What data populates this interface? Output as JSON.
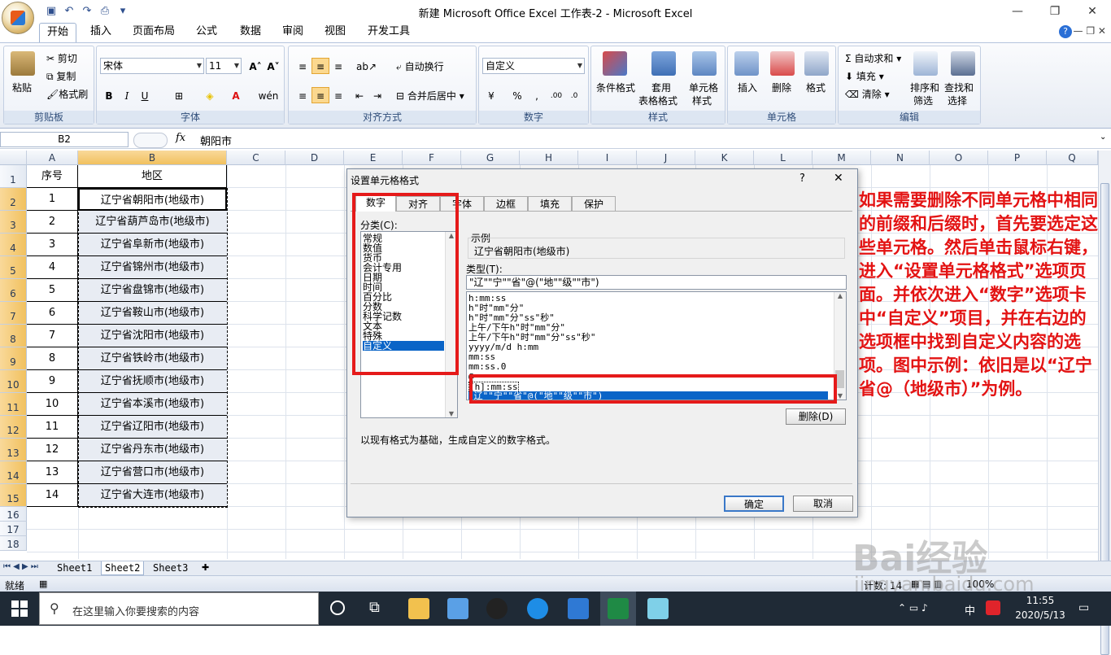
{
  "window": {
    "title": "新建 Microsoft Office Excel 工作表-2 - Microsoft Excel"
  },
  "ribbon_tabs": [
    "开始",
    "插入",
    "页面布局",
    "公式",
    "数据",
    "审阅",
    "视图",
    "开发工具"
  ],
  "ribbon": {
    "clipboard": {
      "label": "剪贴板",
      "paste": "粘贴",
      "cut": "剪切",
      "copy": "复制",
      "format_painter": "格式刷"
    },
    "font": {
      "label": "字体",
      "font_name": "宋体",
      "font_size": "11"
    },
    "alignment": {
      "label": "对齐方式",
      "wrap_text": "自动换行",
      "merge_center": "合并后居中"
    },
    "number": {
      "label": "数字",
      "format": "自定义"
    },
    "styles": {
      "label": "样式",
      "cond_format": "条件格式",
      "table_format_1": "套用",
      "table_format_2": "表格格式",
      "cell_styles_1": "单元格",
      "cell_styles_2": "样式"
    },
    "cells": {
      "label": "单元格",
      "insert": "插入",
      "delete": "删除",
      "format": "格式"
    },
    "editing": {
      "label": "编辑",
      "autosum": "自动求和",
      "fill": "填充",
      "clear": "清除",
      "sort_1": "排序和",
      "sort_2": "筛选",
      "find_1": "查找和",
      "find_2": "选择"
    }
  },
  "formula_bar": {
    "name_box": "B2",
    "fx": "fx",
    "content": "朝阳市"
  },
  "columns": [
    "A",
    "B",
    "C",
    "D",
    "E",
    "F",
    "G",
    "H",
    "I",
    "J",
    "K",
    "L",
    "M",
    "N",
    "O",
    "P",
    "Q"
  ],
  "rows": [
    "1",
    "2",
    "3",
    "4",
    "5",
    "6",
    "7",
    "8",
    "9",
    "10",
    "11",
    "12",
    "13",
    "14",
    "15",
    "16",
    "17",
    "18"
  ],
  "table": {
    "header": {
      "a": "序号",
      "b": "地区"
    },
    "rows": [
      {
        "a": "1",
        "b": "辽宁省朝阳市(地级市)"
      },
      {
        "a": "2",
        "b": "辽宁省葫芦岛市(地级市)"
      },
      {
        "a": "3",
        "b": "辽宁省阜新市(地级市)"
      },
      {
        "a": "4",
        "b": "辽宁省锦州市(地级市)"
      },
      {
        "a": "5",
        "b": "辽宁省盘锦市(地级市)"
      },
      {
        "a": "6",
        "b": "辽宁省鞍山市(地级市)"
      },
      {
        "a": "7",
        "b": "辽宁省沈阳市(地级市)"
      },
      {
        "a": "8",
        "b": "辽宁省铁岭市(地级市)"
      },
      {
        "a": "9",
        "b": "辽宁省抚顺市(地级市)"
      },
      {
        "a": "10",
        "b": "辽宁省本溪市(地级市)"
      },
      {
        "a": "11",
        "b": "辽宁省辽阳市(地级市)"
      },
      {
        "a": "12",
        "b": "辽宁省丹东市(地级市)"
      },
      {
        "a": "13",
        "b": "辽宁省营口市(地级市)"
      },
      {
        "a": "14",
        "b": "辽宁省大连市(地级市)"
      }
    ]
  },
  "sheet_tabs": [
    "Sheet1",
    "Sheet2",
    "Sheet3"
  ],
  "status": {
    "ready": "就绪",
    "count": "计数: 14",
    "zoom": "100%"
  },
  "dialog": {
    "title": "设置单元格格式",
    "help": "?",
    "close": "✕",
    "tabs": [
      "数字",
      "对齐",
      "字体",
      "边框",
      "填充",
      "保护"
    ],
    "category_label": "分类(C):",
    "categories": [
      "常规",
      "数值",
      "货币",
      "会计专用",
      "日期",
      "时间",
      "百分比",
      "分数",
      "科学记数",
      "文本",
      "特殊",
      "自定义"
    ],
    "sample_label": "示例",
    "sample_value": "辽宁省朝阳市(地级市)",
    "type_label": "类型(T):",
    "type_value": "\"辽\"\"宁\"\"省\"@(\"地\"\"级\"\"市\")",
    "type_list": [
      "h:mm:ss",
      "h\"时\"mm\"分\"",
      "h\"时\"mm\"分\"ss\"秒\"",
      "上午/下午h\"时\"mm\"分\"",
      "上午/下午h\"时\"mm\"分\"ss\"秒\"",
      "yyyy/m/d h:mm",
      "mm:ss",
      "mm:ss.0",
      "@",
      "[h]:mm:ss",
      "\"辽\"\"宁\"\"省\"@(\"地\"\"级\"\"市\")"
    ],
    "delete_btn": "删除(D)",
    "description": "以现有格式为基础，生成自定义的数字格式。",
    "ok": "确定",
    "cancel": "取消"
  },
  "annotation": "如果需要删除不同单元格中相同的前缀和后缀时，首先要选定这些单元格。然后单击鼠标右键，进入“设置单元格格式”选项页面。并依次进入“数字”选项卡中“自定义”项目，并在右边的选项框中找到自定义内容的选项。图中示例：依旧是以“辽宁省@（地级市）”为例。",
  "watermark": {
    "brand": "Bai经验",
    "url": "jingyan.baidu.com"
  },
  "taskbar": {
    "search_placeholder": "在这里输入你要搜索的内容",
    "time": "11:55",
    "date": "2020/5/13",
    "ime": "中"
  },
  "colors": {
    "accent_red": "#e31313",
    "selection_blue": "#0a64c7"
  }
}
